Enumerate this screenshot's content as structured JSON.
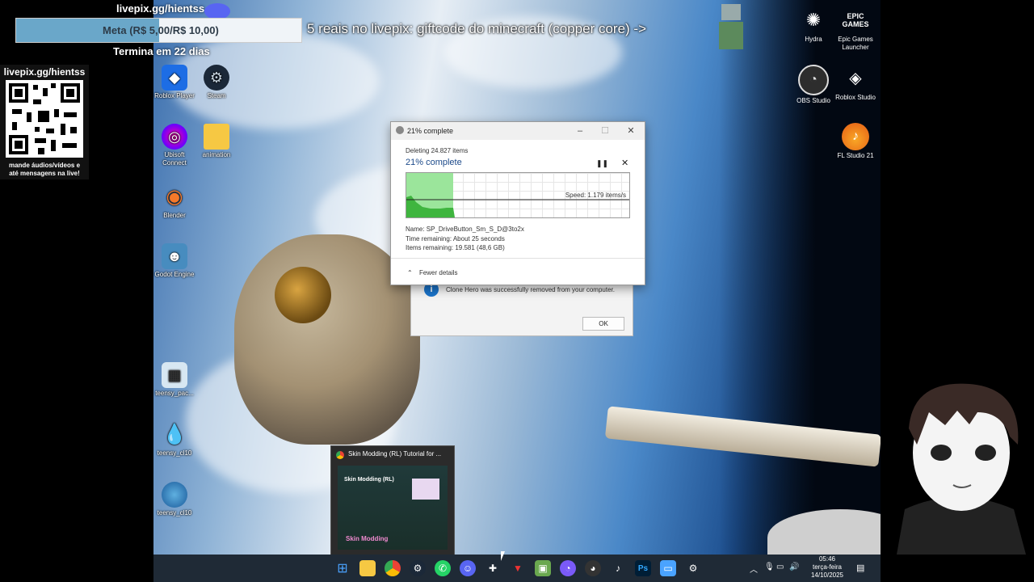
{
  "overlay": {
    "livepix_top": "livepix.gg/hientss",
    "meta_label": "Meta (R$ 5,00/R$ 10,00)",
    "meta_progress": 0.5,
    "ends_in": "Termina em 22 dias",
    "qr_title": "livepix.gg/hientss",
    "qr_caption_1": "mande áudios/vídeos e",
    "qr_caption_2": "até mensagens na live!",
    "banner": "5 reais no livepix: giftcode do minecraft (copper core) ->"
  },
  "desktop_icons_left": [
    {
      "label": "Roblox Player"
    },
    {
      "label": "Steam"
    },
    {
      "label": "Ubisoft Connect"
    },
    {
      "label": "animation"
    },
    {
      "label": "Blender"
    },
    {
      "label": "Godot Engine"
    },
    {
      "label": "teensy_pac..."
    },
    {
      "label": "teensy_cl10"
    },
    {
      "label": "teensy_cl10"
    }
  ],
  "desktop_icons_right": [
    {
      "label": "Hydra"
    },
    {
      "label": "Epic Games Launcher",
      "badge": "EPIC GAMES"
    },
    {
      "label": "OBS Studio"
    },
    {
      "label": "Roblox Studio"
    },
    {
      "label": "FL Studio 21"
    }
  ],
  "remove_dialog": {
    "message": "Clone Hero was successfully removed from your computer.",
    "ok_label": "OK"
  },
  "progress_dialog": {
    "title": "21% complete",
    "deleting": "Deleting 24.827 items",
    "heading": "21% complete",
    "speed": "Speed: 1.179 items/s",
    "name": "Name:  SP_DriveButton_Sm_S_D@3to2x",
    "time_remaining": "Time remaining:  About 25 seconds",
    "items_remaining": "Items remaining:  19.581 (48,6 GB)",
    "fewer_details": "Fewer details",
    "progress": 0.21
  },
  "tab_preview": {
    "title": "Skin Modding (RL) Tutorial for ...",
    "inner_title": "Skin Modding (RL)",
    "inner_bottom": "Skin Modding"
  },
  "tray": {
    "time": "05:46",
    "day": "terça-feira",
    "date": "14/10/2025"
  },
  "colors": {
    "progress_green": "#4cc94c",
    "taskbar": "#1f2a36",
    "meta_fill": "#6aa7c9"
  }
}
